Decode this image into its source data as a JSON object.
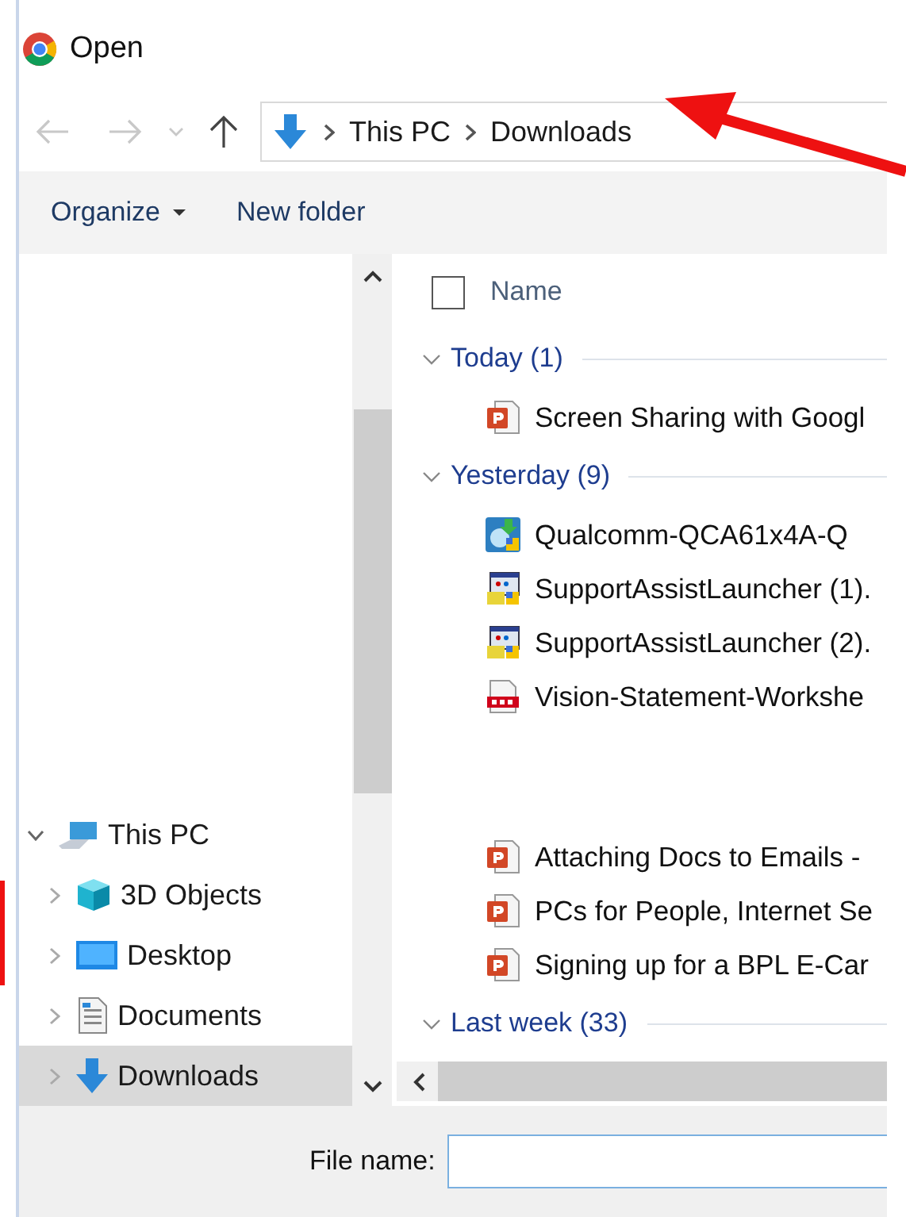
{
  "window": {
    "title": "Open"
  },
  "address_bar": {
    "path": [
      "This PC",
      "Downloads"
    ]
  },
  "toolbar": [
    {
      "label": "Organize",
      "kind": "menu"
    },
    {
      "label": "New folder",
      "kind": "button"
    }
  ],
  "navigation_pane": {
    "items": [
      {
        "label": "This PC",
        "kind": "pc",
        "expanded": true,
        "selected": false,
        "children": [
          {
            "label": "3D Objects",
            "kind": "objects",
            "expanded": false,
            "selected": false
          },
          {
            "label": "Desktop",
            "kind": "desktop",
            "expanded": false,
            "selected": false
          },
          {
            "label": "Documents",
            "kind": "documents",
            "expanded": false,
            "selected": false
          },
          {
            "label": "Downloads",
            "kind": "downloads",
            "expanded": false,
            "selected": true
          }
        ]
      }
    ]
  },
  "file_list": {
    "column": "Name",
    "select_all": {
      "checked": false
    },
    "groups": [
      {
        "label": "Today (1)",
        "expanded": true,
        "files": [
          {
            "name": "Screen Sharing with Googl",
            "kind": "slides"
          }
        ]
      },
      {
        "label": "Yesterday (9)",
        "expanded": true,
        "files": [
          {
            "name": "Qualcomm-QCA61x4A-Q",
            "kind": "installer"
          },
          {
            "name": "SupportAssistLauncher (1).",
            "kind": "app"
          },
          {
            "name": "SupportAssistLauncher (2).",
            "kind": "app"
          },
          {
            "name": "Vision-Statement-Workshe",
            "kind": "pdf"
          },
          {
            "name": "Attaching Docs to Emails -",
            "kind": "slides"
          },
          {
            "name": "PCs for People, Internet Se",
            "kind": "slides"
          },
          {
            "name": "Signing up for a BPL E-Car",
            "kind": "slides"
          }
        ]
      },
      {
        "label": "Last week (33)",
        "expanded": true
      }
    ]
  },
  "file_name": {
    "label": "File name:"
  },
  "annotations": [
    {
      "kind": "arrow"
    },
    {
      "kind": "mark"
    }
  ]
}
